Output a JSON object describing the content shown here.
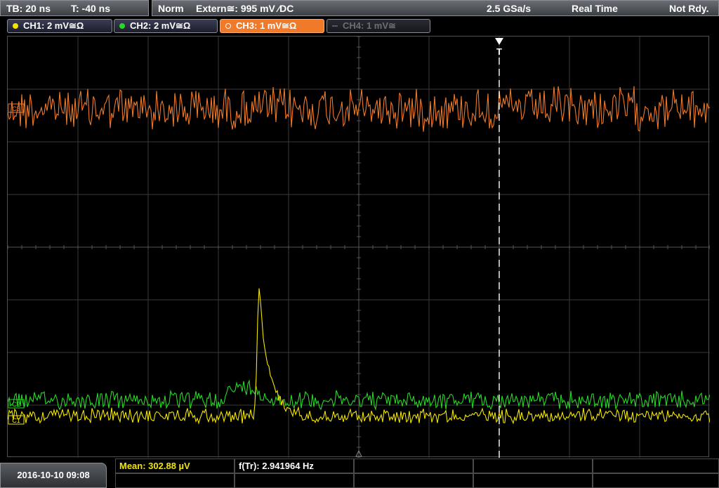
{
  "timebase": {
    "tb_label": "TB: 20 ns",
    "trigger_offset_label": "T: -40 ns"
  },
  "status": {
    "mode": "Norm",
    "trigger_source": "Extern≅: 995 mV ⁄DC",
    "sample_rate": "2.5 GSa/s",
    "acq_mode": "Real Time",
    "trigger_state": "Not Rdy."
  },
  "channels": [
    {
      "label": "CH1: 2 mV≅Ω",
      "color": "#f2e600",
      "state": "on"
    },
    {
      "label": "CH2: 2 mV≅Ω",
      "color": "#27d827",
      "state": "on"
    },
    {
      "label": "CH3: 1 mV≅Ω",
      "color": "#f07a2a",
      "state": "selected"
    },
    {
      "label": "CH4: 1 mV≅",
      "color": "#6c6e76",
      "state": "off"
    }
  ],
  "markers": {
    "trigger_marker": "T",
    "ch3_ref": "C3",
    "ch2_ref": "C2",
    "ch1_ref": "C1"
  },
  "measurements": {
    "mean": "Mean: 302.88 µV",
    "frequency": "f(Tr): 2.941964 Hz"
  },
  "datetime": "2016-10-10 09:08",
  "colors": {
    "ch1": "#f2e600",
    "ch2": "#27d827",
    "ch3": "#f07a2a",
    "grid": "#3a3a3a"
  }
}
